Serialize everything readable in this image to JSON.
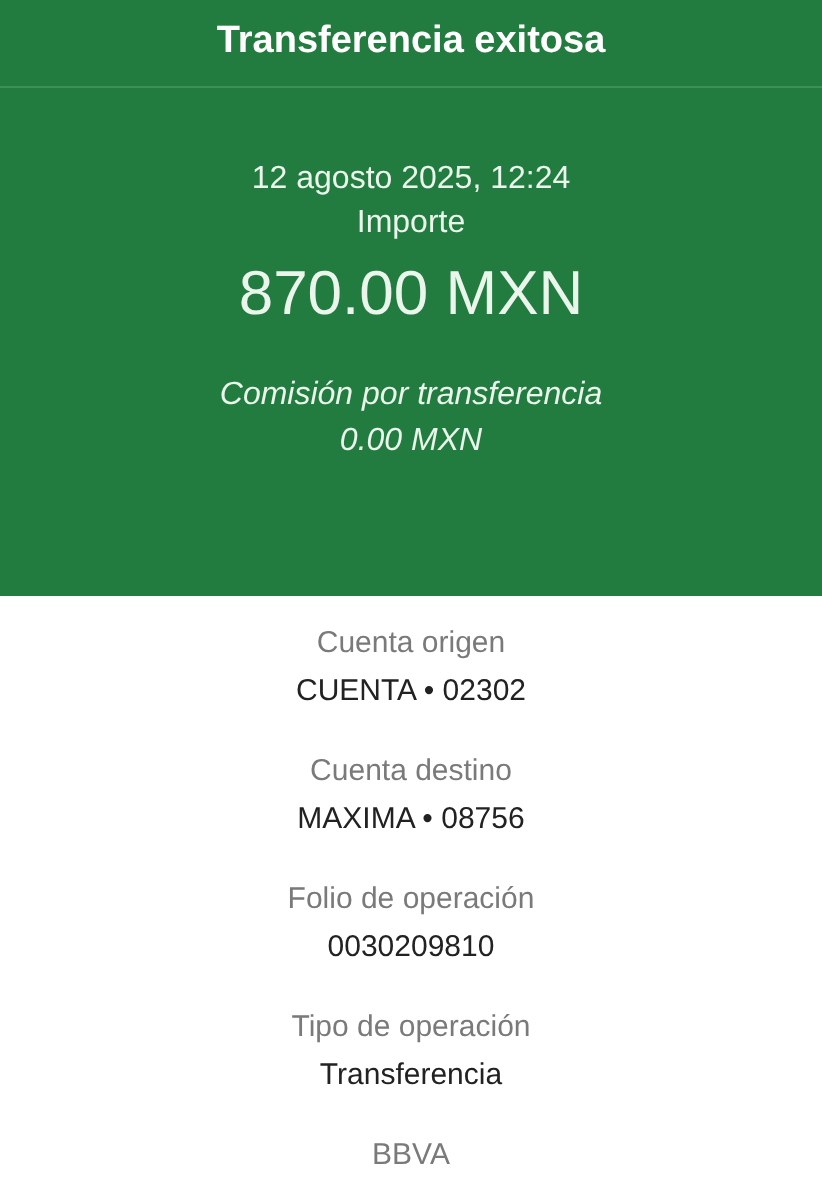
{
  "header": {
    "title": "Transferencia exitosa"
  },
  "summary": {
    "date": "12 agosto 2025, 12:24",
    "amount_label": "Importe",
    "amount": "870.00 MXN",
    "fee_label": "Comisión por transferencia",
    "fee": "0.00 MXN"
  },
  "details": [
    {
      "label": "Cuenta origen",
      "value": "CUENTA • 02302"
    },
    {
      "label": "Cuenta destino",
      "value": "MAXIMA • 08756"
    },
    {
      "label": "Folio de operación",
      "value": "0030209810"
    },
    {
      "label": "Tipo de operación",
      "value": "Transferencia"
    }
  ],
  "bank_label": "BBVA"
}
